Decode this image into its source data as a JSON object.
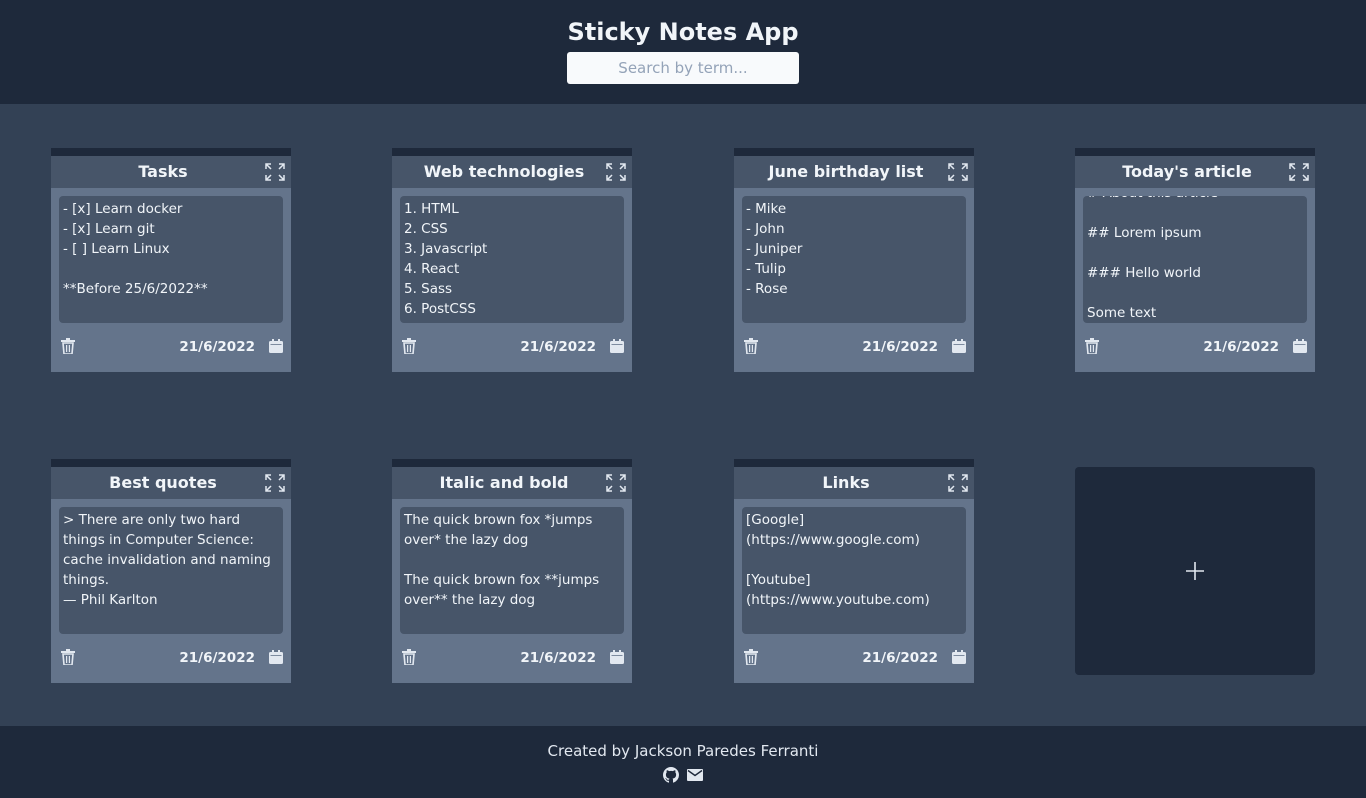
{
  "header": {
    "title": "Sticky Notes App",
    "search_placeholder": "Search by term...",
    "search_value": ""
  },
  "notes": [
    {
      "title": "Tasks",
      "content": "- [x] Learn docker\n- [x] Learn git\n- [ ] Learn Linux\n\n**Before 25/6/2022**",
      "date": "21/6/2022"
    },
    {
      "title": "Web technologies",
      "content": "1. HTML\n2. CSS\n3. Javascript\n4. React\n5. Sass\n6. PostCSS",
      "date": "21/6/2022"
    },
    {
      "title": "June birthday list",
      "content": "- Mike\n- John\n- Juniper\n- Tulip\n- Rose",
      "date": "21/6/2022"
    },
    {
      "title": "Today's article",
      "content": "# About this article\n\n## Lorem ipsum\n\n### Hello world\n\nSome text",
      "date": "21/6/2022"
    },
    {
      "title": "Best quotes",
      "content": "> There are only two hard things in Computer Science: cache invalidation and naming things.\n— Phil Karlton\n\n> Talk is cheap. Show me the",
      "date": "21/6/2022"
    },
    {
      "title": "Italic and bold",
      "content": "The quick brown fox *jumps over* the lazy dog\n\nThe quick brown fox **jumps over** the lazy dog",
      "date": "21/6/2022"
    },
    {
      "title": "Links",
      "content": "[Google]\n(https://www.google.com)\n\n[Youtube]\n(https://www.youtube.com)",
      "date": "21/6/2022"
    }
  ],
  "footer": {
    "credit": "Created by Jackson Paredes Ferranti"
  },
  "icons": {
    "expand": "expand-icon",
    "trash": "trash-icon",
    "calendar": "calendar-icon",
    "add": "plus-icon",
    "github": "github-icon",
    "mail": "mail-icon"
  },
  "colors": {
    "background": "#334155",
    "header": "#1e293b",
    "note": "#64748b",
    "note_body": "#475569"
  }
}
